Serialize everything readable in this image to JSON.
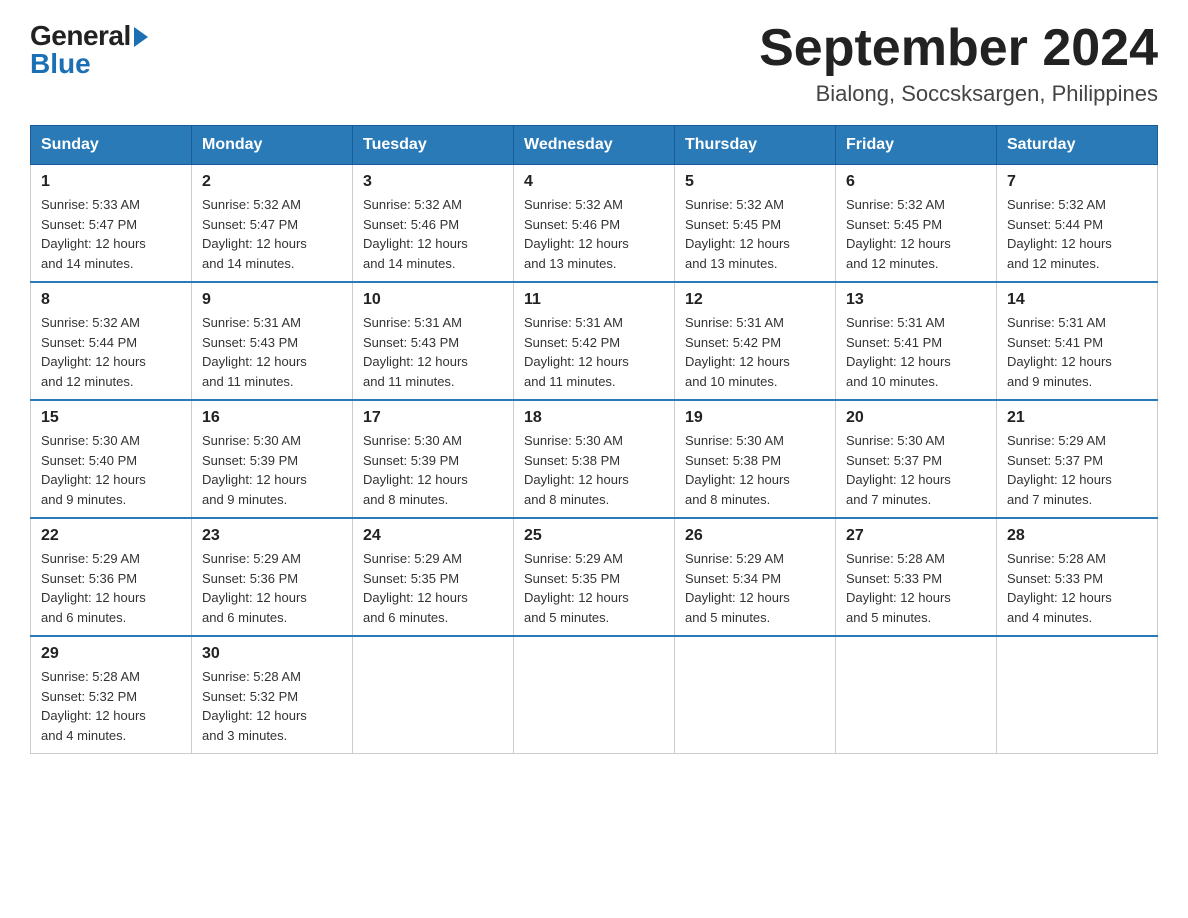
{
  "header": {
    "month_year": "September 2024",
    "location": "Bialong, Soccsksargen, Philippines"
  },
  "logo": {
    "general": "General",
    "blue": "Blue"
  },
  "weekdays": [
    "Sunday",
    "Monday",
    "Tuesday",
    "Wednesday",
    "Thursday",
    "Friday",
    "Saturday"
  ],
  "weeks": [
    [
      {
        "day": "1",
        "sunrise": "5:33 AM",
        "sunset": "5:47 PM",
        "daylight": "12 hours and 14 minutes."
      },
      {
        "day": "2",
        "sunrise": "5:32 AM",
        "sunset": "5:47 PM",
        "daylight": "12 hours and 14 minutes."
      },
      {
        "day": "3",
        "sunrise": "5:32 AM",
        "sunset": "5:46 PM",
        "daylight": "12 hours and 14 minutes."
      },
      {
        "day": "4",
        "sunrise": "5:32 AM",
        "sunset": "5:46 PM",
        "daylight": "12 hours and 13 minutes."
      },
      {
        "day": "5",
        "sunrise": "5:32 AM",
        "sunset": "5:45 PM",
        "daylight": "12 hours and 13 minutes."
      },
      {
        "day": "6",
        "sunrise": "5:32 AM",
        "sunset": "5:45 PM",
        "daylight": "12 hours and 12 minutes."
      },
      {
        "day": "7",
        "sunrise": "5:32 AM",
        "sunset": "5:44 PM",
        "daylight": "12 hours and 12 minutes."
      }
    ],
    [
      {
        "day": "8",
        "sunrise": "5:32 AM",
        "sunset": "5:44 PM",
        "daylight": "12 hours and 12 minutes."
      },
      {
        "day": "9",
        "sunrise": "5:31 AM",
        "sunset": "5:43 PM",
        "daylight": "12 hours and 11 minutes."
      },
      {
        "day": "10",
        "sunrise": "5:31 AM",
        "sunset": "5:43 PM",
        "daylight": "12 hours and 11 minutes."
      },
      {
        "day": "11",
        "sunrise": "5:31 AM",
        "sunset": "5:42 PM",
        "daylight": "12 hours and 11 minutes."
      },
      {
        "day": "12",
        "sunrise": "5:31 AM",
        "sunset": "5:42 PM",
        "daylight": "12 hours and 10 minutes."
      },
      {
        "day": "13",
        "sunrise": "5:31 AM",
        "sunset": "5:41 PM",
        "daylight": "12 hours and 10 minutes."
      },
      {
        "day": "14",
        "sunrise": "5:31 AM",
        "sunset": "5:41 PM",
        "daylight": "12 hours and 9 minutes."
      }
    ],
    [
      {
        "day": "15",
        "sunrise": "5:30 AM",
        "sunset": "5:40 PM",
        "daylight": "12 hours and 9 minutes."
      },
      {
        "day": "16",
        "sunrise": "5:30 AM",
        "sunset": "5:39 PM",
        "daylight": "12 hours and 9 minutes."
      },
      {
        "day": "17",
        "sunrise": "5:30 AM",
        "sunset": "5:39 PM",
        "daylight": "12 hours and 8 minutes."
      },
      {
        "day": "18",
        "sunrise": "5:30 AM",
        "sunset": "5:38 PM",
        "daylight": "12 hours and 8 minutes."
      },
      {
        "day": "19",
        "sunrise": "5:30 AM",
        "sunset": "5:38 PM",
        "daylight": "12 hours and 8 minutes."
      },
      {
        "day": "20",
        "sunrise": "5:30 AM",
        "sunset": "5:37 PM",
        "daylight": "12 hours and 7 minutes."
      },
      {
        "day": "21",
        "sunrise": "5:29 AM",
        "sunset": "5:37 PM",
        "daylight": "12 hours and 7 minutes."
      }
    ],
    [
      {
        "day": "22",
        "sunrise": "5:29 AM",
        "sunset": "5:36 PM",
        "daylight": "12 hours and 6 minutes."
      },
      {
        "day": "23",
        "sunrise": "5:29 AM",
        "sunset": "5:36 PM",
        "daylight": "12 hours and 6 minutes."
      },
      {
        "day": "24",
        "sunrise": "5:29 AM",
        "sunset": "5:35 PM",
        "daylight": "12 hours and 6 minutes."
      },
      {
        "day": "25",
        "sunrise": "5:29 AM",
        "sunset": "5:35 PM",
        "daylight": "12 hours and 5 minutes."
      },
      {
        "day": "26",
        "sunrise": "5:29 AM",
        "sunset": "5:34 PM",
        "daylight": "12 hours and 5 minutes."
      },
      {
        "day": "27",
        "sunrise": "5:28 AM",
        "sunset": "5:33 PM",
        "daylight": "12 hours and 5 minutes."
      },
      {
        "day": "28",
        "sunrise": "5:28 AM",
        "sunset": "5:33 PM",
        "daylight": "12 hours and 4 minutes."
      }
    ],
    [
      {
        "day": "29",
        "sunrise": "5:28 AM",
        "sunset": "5:32 PM",
        "daylight": "12 hours and 4 minutes."
      },
      {
        "day": "30",
        "sunrise": "5:28 AM",
        "sunset": "5:32 PM",
        "daylight": "12 hours and 3 minutes."
      },
      null,
      null,
      null,
      null,
      null
    ]
  ],
  "labels": {
    "sunrise": "Sunrise:",
    "sunset": "Sunset:",
    "daylight": "Daylight:"
  }
}
